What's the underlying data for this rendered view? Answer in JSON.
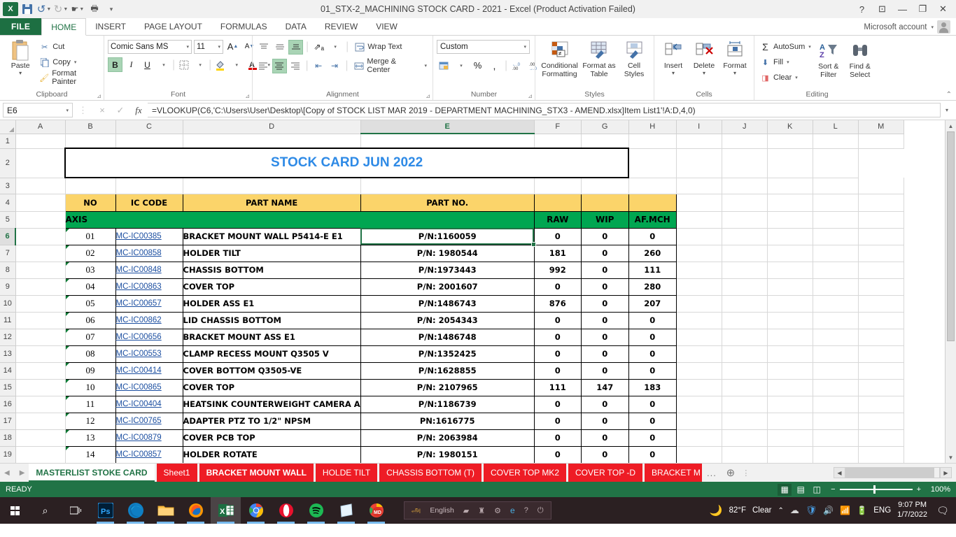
{
  "titlebar": {
    "app_icon": "excel-logo-icon",
    "quick_access": [
      {
        "name": "save-icon",
        "label": "Save"
      },
      {
        "name": "undo-icon",
        "label": "Undo"
      },
      {
        "name": "redo-icon",
        "label": "Redo"
      },
      {
        "name": "touch-mode-icon",
        "label": "Touch/Mouse Mode"
      },
      {
        "name": "print-preview-icon",
        "label": "Print Preview and Print"
      },
      {
        "name": "customize-qat-icon",
        "label": "Customize Quick Access Toolbar"
      }
    ],
    "title": "01_STX-2_MACHINING STOCK CARD - 2021 - Excel (Product Activation Failed)",
    "window_buttons": [
      "?",
      "ribbon-display-options",
      "minimize",
      "restore",
      "close"
    ]
  },
  "ribbon_tabs": {
    "file": "FILE",
    "tabs": [
      "HOME",
      "INSERT",
      "PAGE LAYOUT",
      "FORMULAS",
      "DATA",
      "REVIEW",
      "VIEW"
    ],
    "active": "HOME",
    "account_label": "Microsoft account"
  },
  "ribbon": {
    "clipboard": {
      "label": "Clipboard",
      "paste": "Paste",
      "cut": "Cut",
      "copy": "Copy",
      "format_painter": "Format Painter"
    },
    "font": {
      "label": "Font",
      "font_name": "Comic Sans MS",
      "font_size": "11",
      "grow": "A",
      "shrink": "A",
      "bold": "B",
      "italic": "I",
      "underline": "U",
      "borders": "borders",
      "fill_color": "fill-color",
      "font_color": "font-color"
    },
    "alignment": {
      "label": "Alignment",
      "wrap_text": "Wrap Text",
      "merge_center": "Merge & Center",
      "orientation": "orientation"
    },
    "number": {
      "label": "Number",
      "format": "Custom",
      "percent": "%",
      "comma": ",",
      "increase_decimal": ".00",
      "decrease_decimal": ".00"
    },
    "styles": {
      "label": "Styles",
      "conditional_formatting": "Conditional Formatting",
      "format_as_table": "Format as Table",
      "cell_styles": "Cell Styles"
    },
    "cells": {
      "label": "Cells",
      "insert": "Insert",
      "delete": "Delete",
      "format": "Format"
    },
    "editing": {
      "label": "Editing",
      "autosum": "AutoSum",
      "fill": "Fill",
      "clear": "Clear",
      "sort_filter": "Sort & Filter",
      "find_select": "Find & Select"
    }
  },
  "formula_bar": {
    "name_box": "E6",
    "cancel": "×",
    "enter": "✓",
    "insert_function": "fx",
    "formula": "=VLOOKUP(C6,'C:\\Users\\User\\Desktop\\[Copy of STOCK LIST MAR 2019 - DEPARTMENT MACHINING_STX3 - AMEND.xlsx]Item List1'!A:D,4,0)"
  },
  "grid": {
    "columns": [
      "A",
      "B",
      "C",
      "D",
      "E",
      "F",
      "G",
      "H",
      "I",
      "J",
      "K",
      "L",
      "M"
    ],
    "selected_column": "E",
    "selected_row": "6",
    "rows": [
      "1",
      "2",
      "3",
      "4",
      "5",
      "6",
      "7",
      "8",
      "9",
      "10",
      "11",
      "12",
      "13",
      "14",
      "15",
      "16",
      "17",
      "18",
      "19"
    ],
    "title_cell": "STOCK CARD JUN 2022",
    "headers": {
      "no": "NO",
      "ic_code": "IC CODE",
      "part_name": "PART NAME",
      "part_no": "PART NO.",
      "raw": "RAW",
      "wip": "WIP",
      "af_mch": "AF.MCH"
    },
    "section_label": "AXIS",
    "data": [
      {
        "no": "01",
        "code": "MC-IC00385",
        "name": "BRACKET MOUNT WALL P5414-E E1",
        "pn": "P/N:1160059",
        "raw": "0",
        "wip": "0",
        "af": "0"
      },
      {
        "no": "02",
        "code": "MC-IC00858",
        "name": "HOLDER TILT",
        "pn": "P/N: 1980544",
        "raw": "181",
        "wip": "0",
        "af": "260"
      },
      {
        "no": "03",
        "code": "MC-IC00848",
        "name": "CHASSIS BOTTOM",
        "pn": "P/N:1973443",
        "raw": "992",
        "wip": "0",
        "af": "111"
      },
      {
        "no": "04",
        "code": "MC-IC00863",
        "name": "COVER TOP",
        "pn": "P/N: 2001607",
        "raw": "0",
        "wip": "0",
        "af": "280"
      },
      {
        "no": "05",
        "code": "MC-IC00657",
        "name": "HOLDER ASS E1",
        "pn": "P/N:1486743",
        "raw": "876",
        "wip": "0",
        "af": "207"
      },
      {
        "no": "06",
        "code": "MC-IC00862",
        "name": "LID CHASSIS BOTTOM",
        "pn": "P/N: 2054343",
        "raw": "0",
        "wip": "0",
        "af": "0"
      },
      {
        "no": "07",
        "code": "MC-IC00656",
        "name": "BRACKET  MOUNT ASS E1",
        "pn": "P/N:1486748",
        "raw": "0",
        "wip": "0",
        "af": "0"
      },
      {
        "no": "08",
        "code": "MC-IC00553",
        "name": "CLAMP RECESS MOUNT Q3505 V",
        "pn": "P/N:1352425",
        "raw": "0",
        "wip": "0",
        "af": "0"
      },
      {
        "no": "09",
        "code": "MC-IC00414",
        "name": "COVER BOTTOM Q3505-VE",
        "pn": "P/N:1628855",
        "raw": "0",
        "wip": "0",
        "af": "0"
      },
      {
        "no": "10",
        "code": "MC-IC00865",
        "name": "COVER TOP",
        "pn": "P/N: 2107965",
        "raw": "111",
        "wip": "147",
        "af": "183"
      },
      {
        "no": "11",
        "code": "MC-IC00404",
        "name": "HEATSINK COUNTERWEIGHT CAMERA A",
        "pn": "P/N:1186739",
        "raw": "0",
        "wip": "0",
        "af": "0"
      },
      {
        "no": "12",
        "code": "MC-IC00765",
        "name": "ADAPTER PTZ TO 1/2\" NPSM",
        "pn": "PN:1616775",
        "raw": "0",
        "wip": "0",
        "af": "0"
      },
      {
        "no": "13",
        "code": "MC-IC00879",
        "name": "COVER PCB TOP",
        "pn": "P/N: 2063984",
        "raw": "0",
        "wip": "0",
        "af": "0"
      },
      {
        "no": "14",
        "code": "MC-IC00857",
        "name": "HOLDER ROTATE",
        "pn": "P/N: 1980151",
        "raw": "0",
        "wip": "0",
        "af": "0"
      }
    ],
    "colors": {
      "title_text": "#2e8ae6",
      "header_fill": "#fbd46a",
      "section_fill": "#00a651",
      "hyperlink": "#1c4fa1",
      "tab_red": "#ee1c25",
      "excel_green": "#217346"
    }
  },
  "sheet_tabs": {
    "tabs": [
      {
        "label": "MASTERLIST STOKE CARD",
        "active": true
      },
      {
        "label": "Sheet1",
        "active": false
      },
      {
        "label": "BRACKET MOUNT WALL",
        "active": false
      },
      {
        "label": "HOLDE TILT",
        "active": false
      },
      {
        "label": "CHASSIS BOTTOM (T)",
        "active": false
      },
      {
        "label": "COVER TOP MK2",
        "active": false
      },
      {
        "label": "COVER TOP -D",
        "active": false
      },
      {
        "label": "BRACKET M",
        "active": false
      }
    ],
    "overflow": "...",
    "add_sheet": "+"
  },
  "status_bar": {
    "state": "READY",
    "views": [
      "normal-view",
      "page-layout-view",
      "page-break-view"
    ],
    "zoom": "100%",
    "zoom_out": "−",
    "zoom_in": "+"
  },
  "taskbar": {
    "items": [
      {
        "name": "start-button",
        "label": "Start"
      },
      {
        "name": "search-icon",
        "label": "Search"
      },
      {
        "name": "task-view-icon",
        "label": "Task View"
      },
      {
        "name": "photoshop-icon",
        "label": "Ps"
      },
      {
        "name": "edge-icon",
        "label": "Microsoft Edge"
      },
      {
        "name": "file-explorer-icon",
        "label": "File Explorer"
      },
      {
        "name": "firefox-icon",
        "label": "Firefox"
      },
      {
        "name": "excel-taskbar-icon",
        "label": "Excel"
      },
      {
        "name": "chrome-icon",
        "label": "Chrome"
      },
      {
        "name": "opera-icon",
        "label": "Opera"
      },
      {
        "name": "spotify-icon",
        "label": "Spotify"
      },
      {
        "name": "sticky-notes-icon",
        "label": "Sticky Notes"
      },
      {
        "name": "chrome-md-icon",
        "label": "MD"
      }
    ],
    "language_bar": {
      "label": "English",
      "tools": [
        "ime-pad-icon",
        "handwriting-icon",
        "settings-icon",
        "ie-icon",
        "help-icon",
        "power-icon"
      ]
    },
    "weather": {
      "icon": "moon-icon",
      "temperature": "82°F",
      "condition": "Clear"
    },
    "tray": [
      "show-hidden-icons",
      "onedrive-icon",
      "security-icon",
      "volume-icon",
      "network-icon",
      "battery-icon"
    ],
    "input_language": "ENG",
    "time": "9:07 PM",
    "date": "1/7/2022",
    "action_center": "notifications-icon"
  }
}
